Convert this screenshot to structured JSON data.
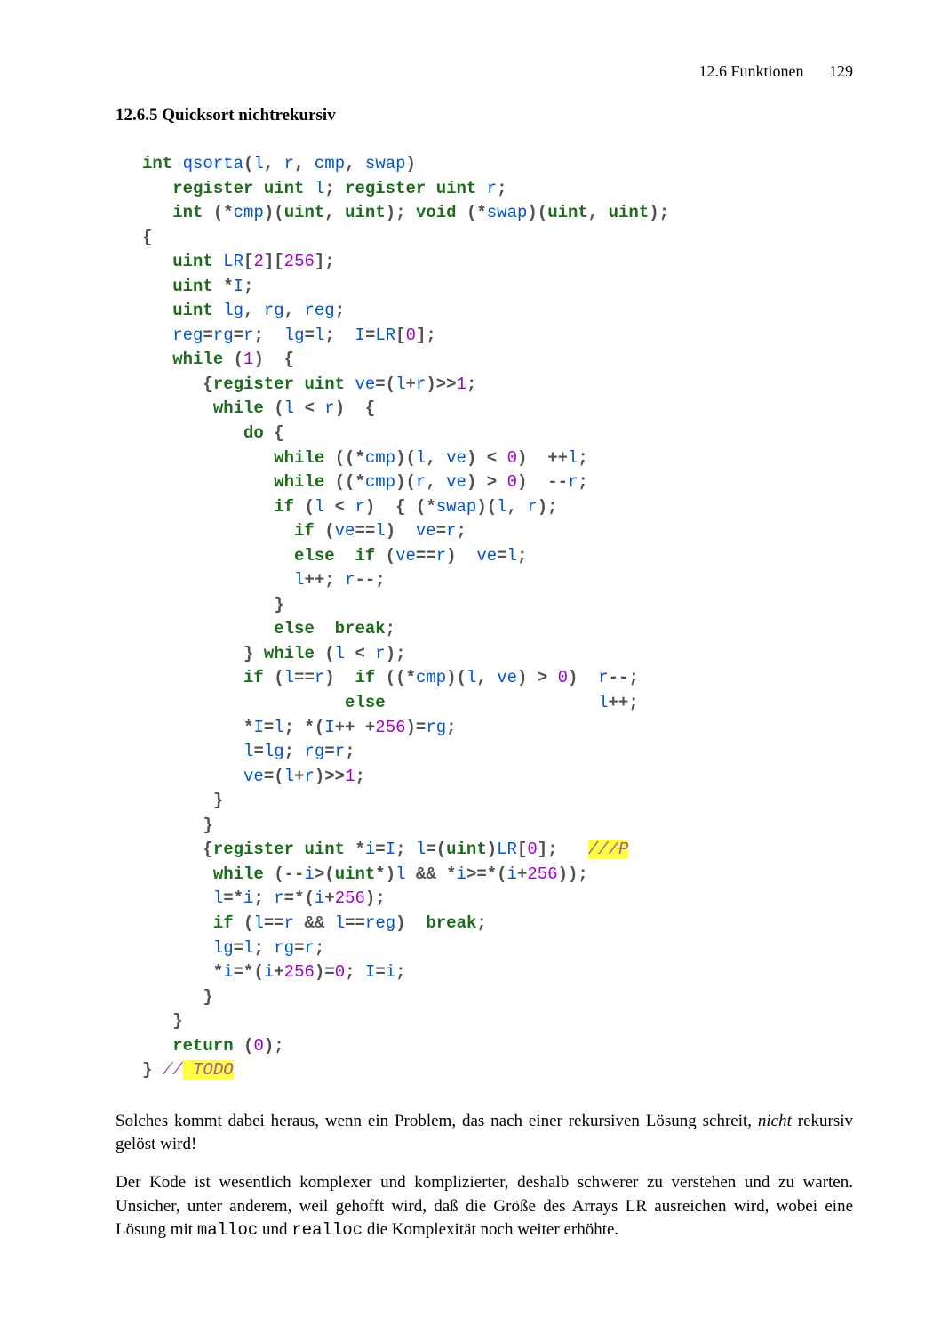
{
  "header": {
    "section_ref": "12.6 Funktionen",
    "page_num": "129"
  },
  "section_title": "12.6.5 Quicksort nichtrekursiv",
  "code": {
    "kw_int": "int",
    "kw_register": "register",
    "kw_uint": "uint",
    "kw_void": "void",
    "kw_while": "while",
    "kw_do": "do",
    "kw_if": "if",
    "kw_else": "else",
    "kw_break": "break",
    "kw_return": "return",
    "fn_qsorta": "qsorta",
    "id_l": "l",
    "id_r": "r",
    "id_cmp": "cmp",
    "id_swap": "swap",
    "id_LR": "LR",
    "id_I": "I",
    "id_lg": "lg",
    "id_rg": "rg",
    "id_reg": "reg",
    "id_ve": "ve",
    "id_i": "i",
    "n0": "0",
    "n1": "1",
    "n2": "2",
    "n256": "256",
    "cm_p": "///P",
    "cm_slashes": "//",
    "cm_todo": " TODO"
  },
  "para1_a": "Solches kommt dabei heraus, wenn ein Problem, das nach einer rekursiven Lösung schreit, ",
  "para1_em": "nicht",
  "para1_b": " rekursiv gelöst wird!",
  "para2_a": "Der Kode ist wesentlich komplexer und komplizierter, deshalb schwerer zu verstehen und zu warten. Unsicher, unter anderem, weil gehofft wird, daß die Größe des Arrays LR ausreichen wird, wobei eine Lösung mit ",
  "para2_c1": "malloc",
  "para2_b": " und ",
  "para2_c2": "realloc",
  "para2_c": " die Komplexität noch weiter erhöhte."
}
